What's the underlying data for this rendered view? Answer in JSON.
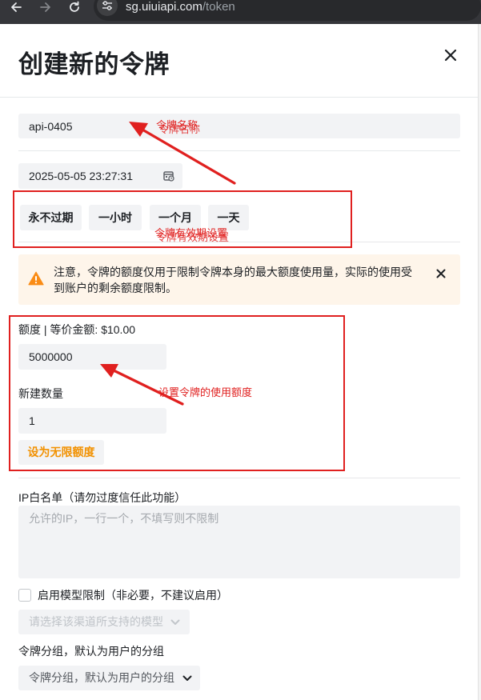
{
  "browser": {
    "url_host": "sg.uiuiapi.com",
    "url_path": "/token"
  },
  "modal": {
    "title": "创建新的令牌"
  },
  "form": {
    "name": {
      "value": "api-0405"
    },
    "expiry": {
      "value": "2025-05-05 23:27:31",
      "presets": [
        "永不过期",
        "一小时",
        "一个月",
        "一天"
      ]
    },
    "warning": {
      "lines": [
        "注意，令牌的额度仅用于限制令牌本身的最大额度使用量，实际的使用受",
        "到账户的剩余额度限制。"
      ]
    },
    "quota": {
      "label": "额度 | 等价金额: $10.00",
      "value": "5000000"
    },
    "count": {
      "label": "新建数量",
      "value": "1"
    },
    "unlimited_button": "设为无限额度",
    "ip_whitelist": {
      "label": "IP白名单（请勿过度信任此功能）",
      "placeholder": "允许的IP，一行一个，不填写则不限制"
    },
    "model_limit": {
      "label": "启用模型限制（非必要，不建议启用）",
      "checked": false,
      "select_placeholder": "请选择该渠道所支持的模型"
    },
    "group": {
      "label": "令牌分组，默认为用户的分组",
      "select_placeholder": "令牌分组，默认为用户的分组"
    }
  },
  "annotations": {
    "token_name": "令牌名称",
    "expiry_setting": "令牌有效期设置",
    "quota_setting": "设置令牌的使用额度"
  },
  "icons": {
    "back": "arrow-left-icon",
    "forward": "arrow-right-icon",
    "reload": "reload-icon",
    "site_info": "tune-icon",
    "close": "close-icon",
    "calendar": "calendar-icon",
    "warning": "warning-icon",
    "select": "chevron-down-icon"
  },
  "colors": {
    "annotation_red": "#e0201f",
    "warning_orange": "#fa8c16",
    "accent_orange": "#f29100",
    "input_bg": "#f2f3f5",
    "warning_bg": "#fef5ea"
  }
}
